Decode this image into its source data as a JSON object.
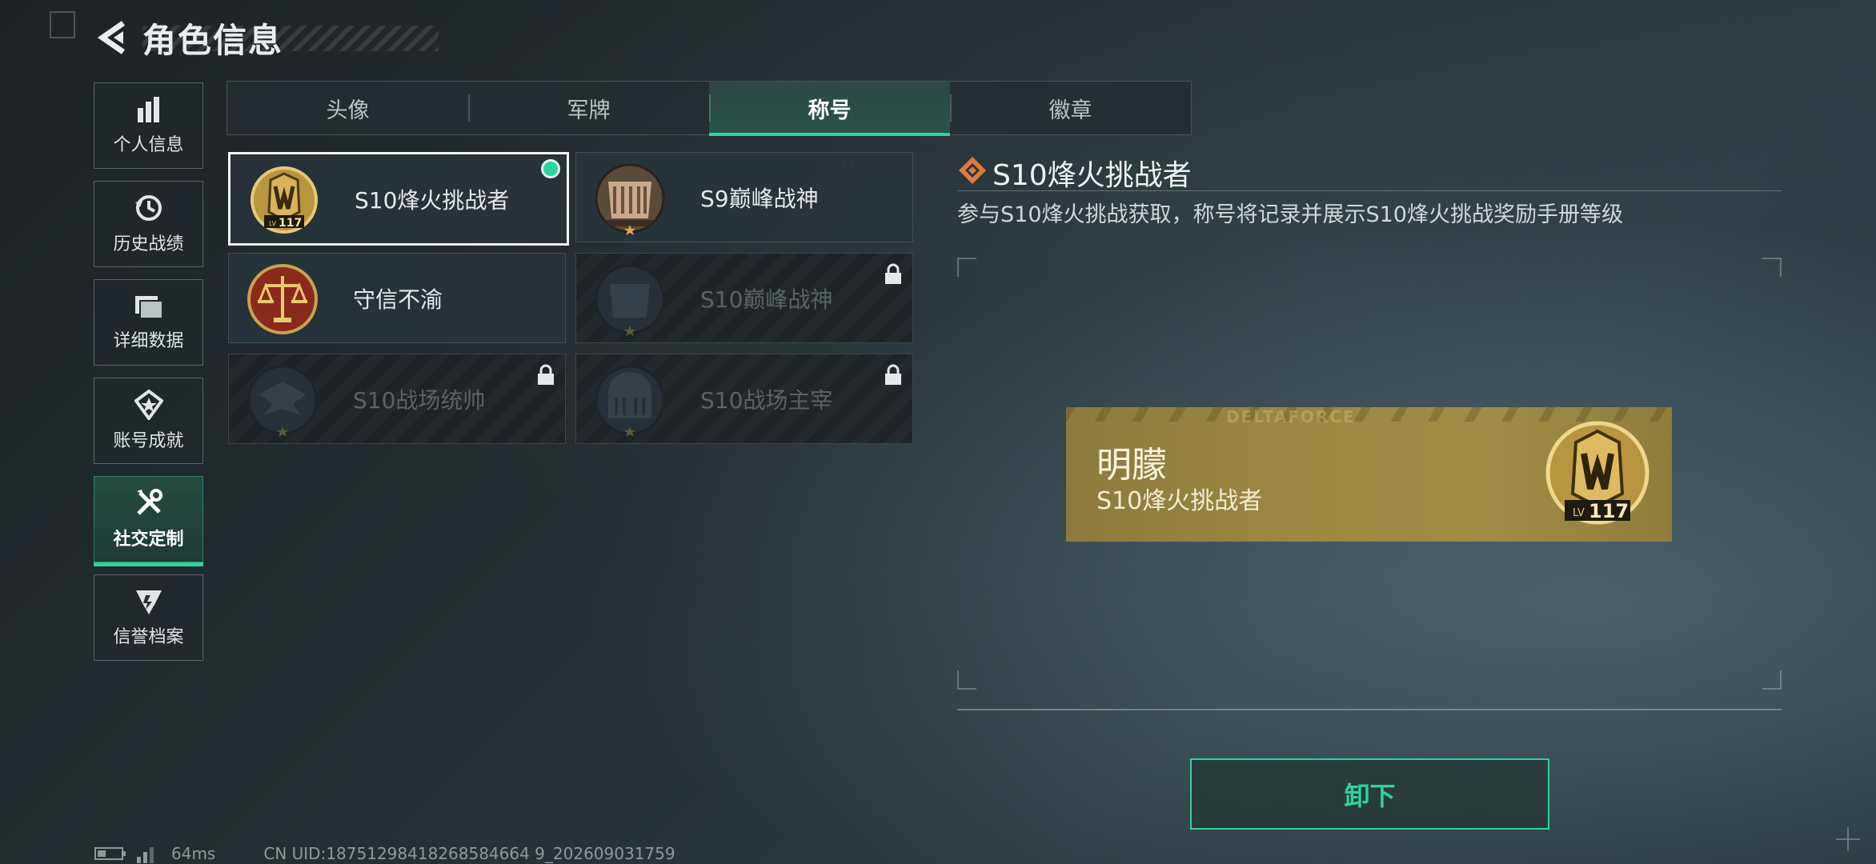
{
  "header": {
    "title": "角色信息"
  },
  "sidebar": {
    "items": [
      {
        "label": "个人信息",
        "icon": "bar-chart-icon"
      },
      {
        "label": "历史战绩",
        "icon": "history-icon"
      },
      {
        "label": "详细数据",
        "icon": "folder-icon"
      },
      {
        "label": "账号成就",
        "icon": "achievement-icon"
      },
      {
        "label": "社交定制",
        "icon": "tools-icon",
        "active": true
      },
      {
        "label": "信誉档案",
        "icon": "reputation-icon"
      }
    ]
  },
  "tabs": [
    {
      "label": "头像"
    },
    {
      "label": "军牌"
    },
    {
      "label": "称号",
      "active": true
    },
    {
      "label": "徽章"
    }
  ],
  "titles": [
    {
      "name": "S10烽火挑战者",
      "level": "117",
      "selected": true,
      "equipped": true,
      "locked": false
    },
    {
      "name": "S9巅峰战神",
      "locked": false
    },
    {
      "name": "守信不渝",
      "locked": false
    },
    {
      "name": "S10巅峰战神",
      "locked": true
    },
    {
      "name": "S10战场统帅",
      "locked": true
    },
    {
      "name": "S10战场主宰",
      "locked": true
    }
  ],
  "detail": {
    "title": "S10烽火挑战者",
    "description": "参与S10烽火挑战获取，称号将记录并展示S10烽火挑战奖励手册等级"
  },
  "preview": {
    "brand": "DELTAFORCE",
    "player_name": "明朦",
    "title": "S10烽火挑战者",
    "level": "117",
    "lv_label": "LV"
  },
  "actions": {
    "unequip_label": "卸下"
  },
  "status": {
    "ping": "64ms",
    "uid": "CN UID:18751298418268584664 9_202609031759"
  },
  "colors": {
    "accent": "#2fd49a",
    "gold": "#a08c45"
  }
}
